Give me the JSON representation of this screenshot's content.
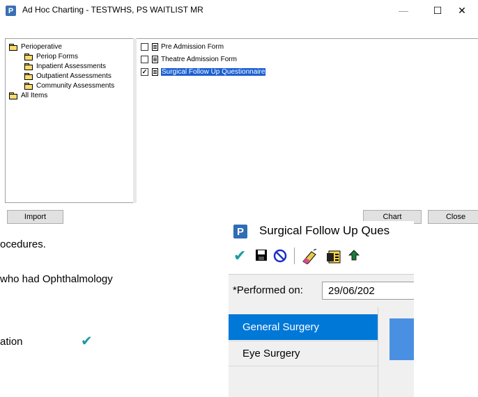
{
  "window": {
    "icon_letter": "P",
    "title": "Ad Hoc Charting - TESTWHS, PS WAITLIST  MR",
    "minimize": "—",
    "maximize": "☐",
    "close": "✕"
  },
  "tree": {
    "items": [
      {
        "label": "Perioperative"
      },
      {
        "label": "Periop Forms"
      },
      {
        "label": "Inpatient Assessments"
      },
      {
        "label": "Outpatient Assessments"
      },
      {
        "label": "Community Assessments"
      },
      {
        "label": "All Items"
      }
    ]
  },
  "forms": {
    "items": [
      {
        "label": "Pre Admission Form",
        "checked": false
      },
      {
        "label": "Theatre Admission Form",
        "checked": false
      },
      {
        "label": "Surgical Follow Up Questionnaire",
        "checked": true,
        "selected": true
      }
    ],
    "check_mark": "✓"
  },
  "buttons": {
    "import": "Import",
    "chart": "Chart",
    "close": "Close"
  },
  "document": {
    "line1": "ocedures.",
    "line2": " who had Ophthalmology",
    "line3": "ation",
    "tick": "✔"
  },
  "inset": {
    "icon_letter": "P",
    "title": "Surgical Follow Up Ques",
    "toolbar_icons": [
      "checkmark-icon",
      "save-icon",
      "cancel-icon",
      "eraser-icon",
      "form-icon",
      "up-arrow-icon"
    ],
    "performed_label": "*Performed on:",
    "performed_value": "29/06/202",
    "nav_items": [
      {
        "label": "General Surgery",
        "selected": true
      },
      {
        "label": "Eye Surgery",
        "selected": false
      }
    ]
  },
  "colors": {
    "selection_blue": "#1b5fd1",
    "nav_selected": "#0078d7",
    "icon_blue": "#3a6fb5",
    "folder_yellow": "#f7dc6f",
    "check_teal": "#1a9aa0"
  }
}
